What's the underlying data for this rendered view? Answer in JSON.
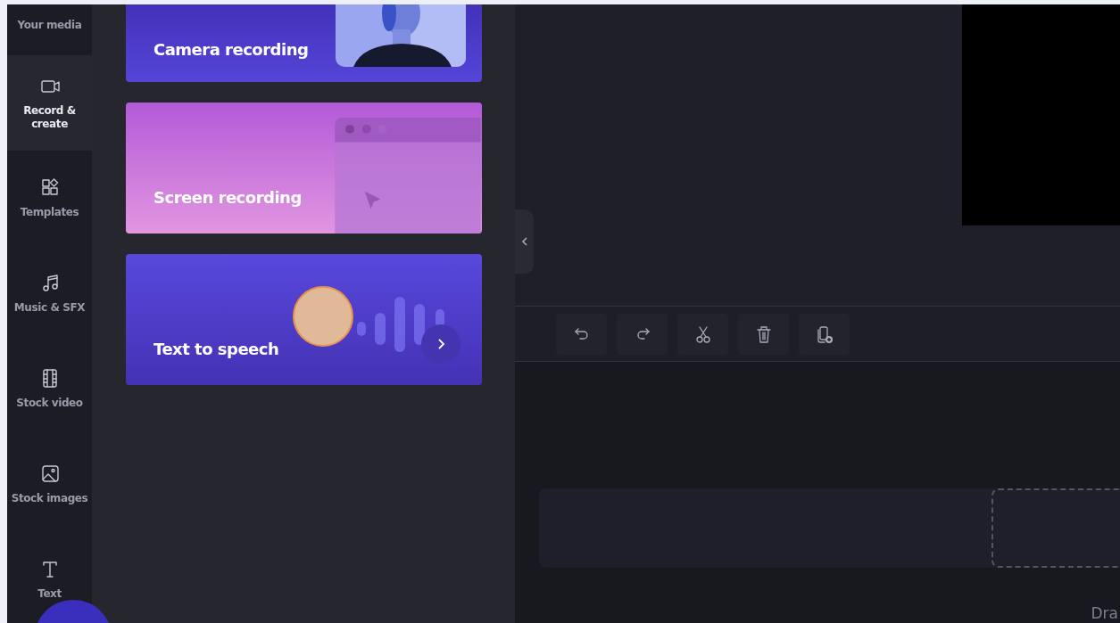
{
  "sidebar": {
    "items": [
      {
        "label": "Your media",
        "selected": false
      },
      {
        "label": "Record & create",
        "selected": true
      },
      {
        "label": "Templates",
        "selected": false
      },
      {
        "label": "Music & SFX",
        "selected": false
      },
      {
        "label": "Stock video",
        "selected": false
      },
      {
        "label": "Stock images",
        "selected": false
      },
      {
        "label": "Text",
        "selected": false
      }
    ]
  },
  "cards": [
    {
      "title": "Camera recording",
      "kind": "camera"
    },
    {
      "title": "Screen recording",
      "kind": "screen"
    },
    {
      "title": "Text to speech",
      "kind": "speech"
    }
  ],
  "timeline": {
    "hint": "Dra"
  }
}
